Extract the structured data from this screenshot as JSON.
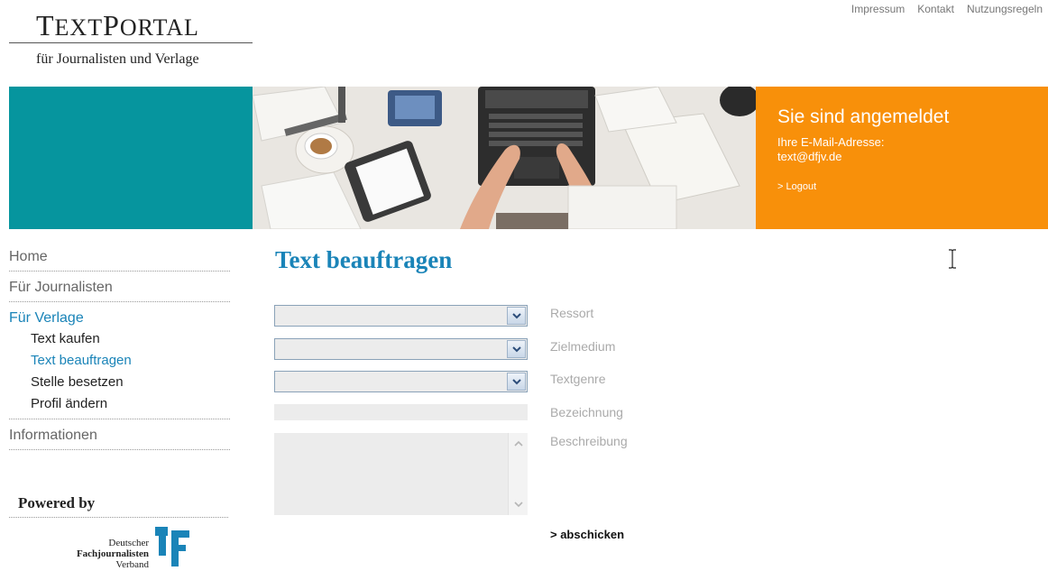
{
  "header": {
    "logo_first_big": "T",
    "logo_first_rest": "EXT",
    "logo_second_big": "P",
    "logo_second_rest": "ORTAL",
    "logo_subtitle": "für Journalisten und Verlage",
    "top_links": [
      "Impressum",
      "Kontakt",
      "Nutzungsregeln"
    ]
  },
  "banner": {
    "status_heading": "Sie sind angemeldet",
    "email_label": "Ihre E-Mail-Adresse:",
    "email_value": "text@dfjv.de",
    "logout_label": "> Logout"
  },
  "nav": {
    "home": "Home",
    "journalists": "Für Journalisten",
    "publishers": "Für Verlage",
    "sub_items": [
      "Text kaufen",
      "Text beauftragen",
      "Stelle besetzen",
      "Profil ändern"
    ],
    "active_sub": 1,
    "info": "Informationen"
  },
  "powered": {
    "label": "Powered by",
    "org_line1": "Deutscher",
    "org_line2": "Fachjournalisten",
    "org_line3": "Verband"
  },
  "form": {
    "title": "Text beauftragen",
    "labels": {
      "ressort": "Ressort",
      "zielmedium": "Zielmedium",
      "textgenre": "Textgenre",
      "bezeichnung": "Bezeichnung",
      "beschreibung": "Beschreibung"
    },
    "values": {
      "ressort": "",
      "zielmedium": "",
      "textgenre": "",
      "bezeichnung": "",
      "beschreibung": ""
    },
    "submit_label": "> abschicken"
  },
  "colors": {
    "teal": "#06959e",
    "orange": "#f8900a",
    "link_blue": "#1a84b8"
  }
}
